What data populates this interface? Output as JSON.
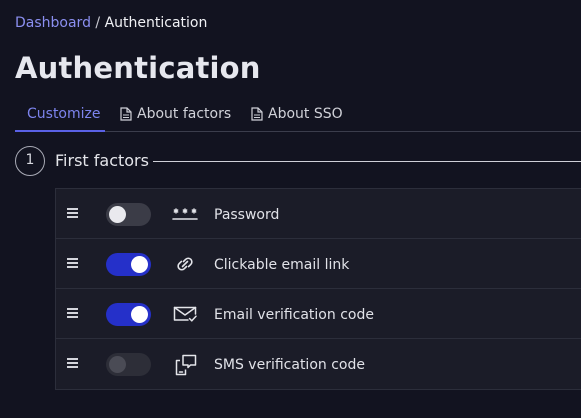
{
  "breadcrumb": {
    "parent": "Dashboard",
    "separator": " / ",
    "current": "Authentication"
  },
  "page": {
    "title": "Authentication"
  },
  "tabs": [
    {
      "label": "Customize",
      "active": true,
      "icon": ""
    },
    {
      "label": "About factors",
      "active": false,
      "icon": "document-icon"
    },
    {
      "label": "About SSO",
      "active": false,
      "icon": "document-icon"
    }
  ],
  "section": {
    "step": "1",
    "label": "First factors"
  },
  "factors": [
    {
      "label": "Password",
      "enabled": false,
      "disabled": false,
      "icon": "password-asterisks-icon"
    },
    {
      "label": "Clickable email link",
      "enabled": true,
      "disabled": false,
      "icon": "link-icon"
    },
    {
      "label": "Email verification code",
      "enabled": true,
      "disabled": false,
      "icon": "email-check-icon"
    },
    {
      "label": "SMS verification code",
      "enabled": false,
      "disabled": true,
      "icon": "phone-message-icon"
    }
  ],
  "colors": {
    "background": "#121320",
    "accent": "#5a61e6",
    "toggle_on": "#2530c9",
    "link": "#8b8ff0"
  }
}
